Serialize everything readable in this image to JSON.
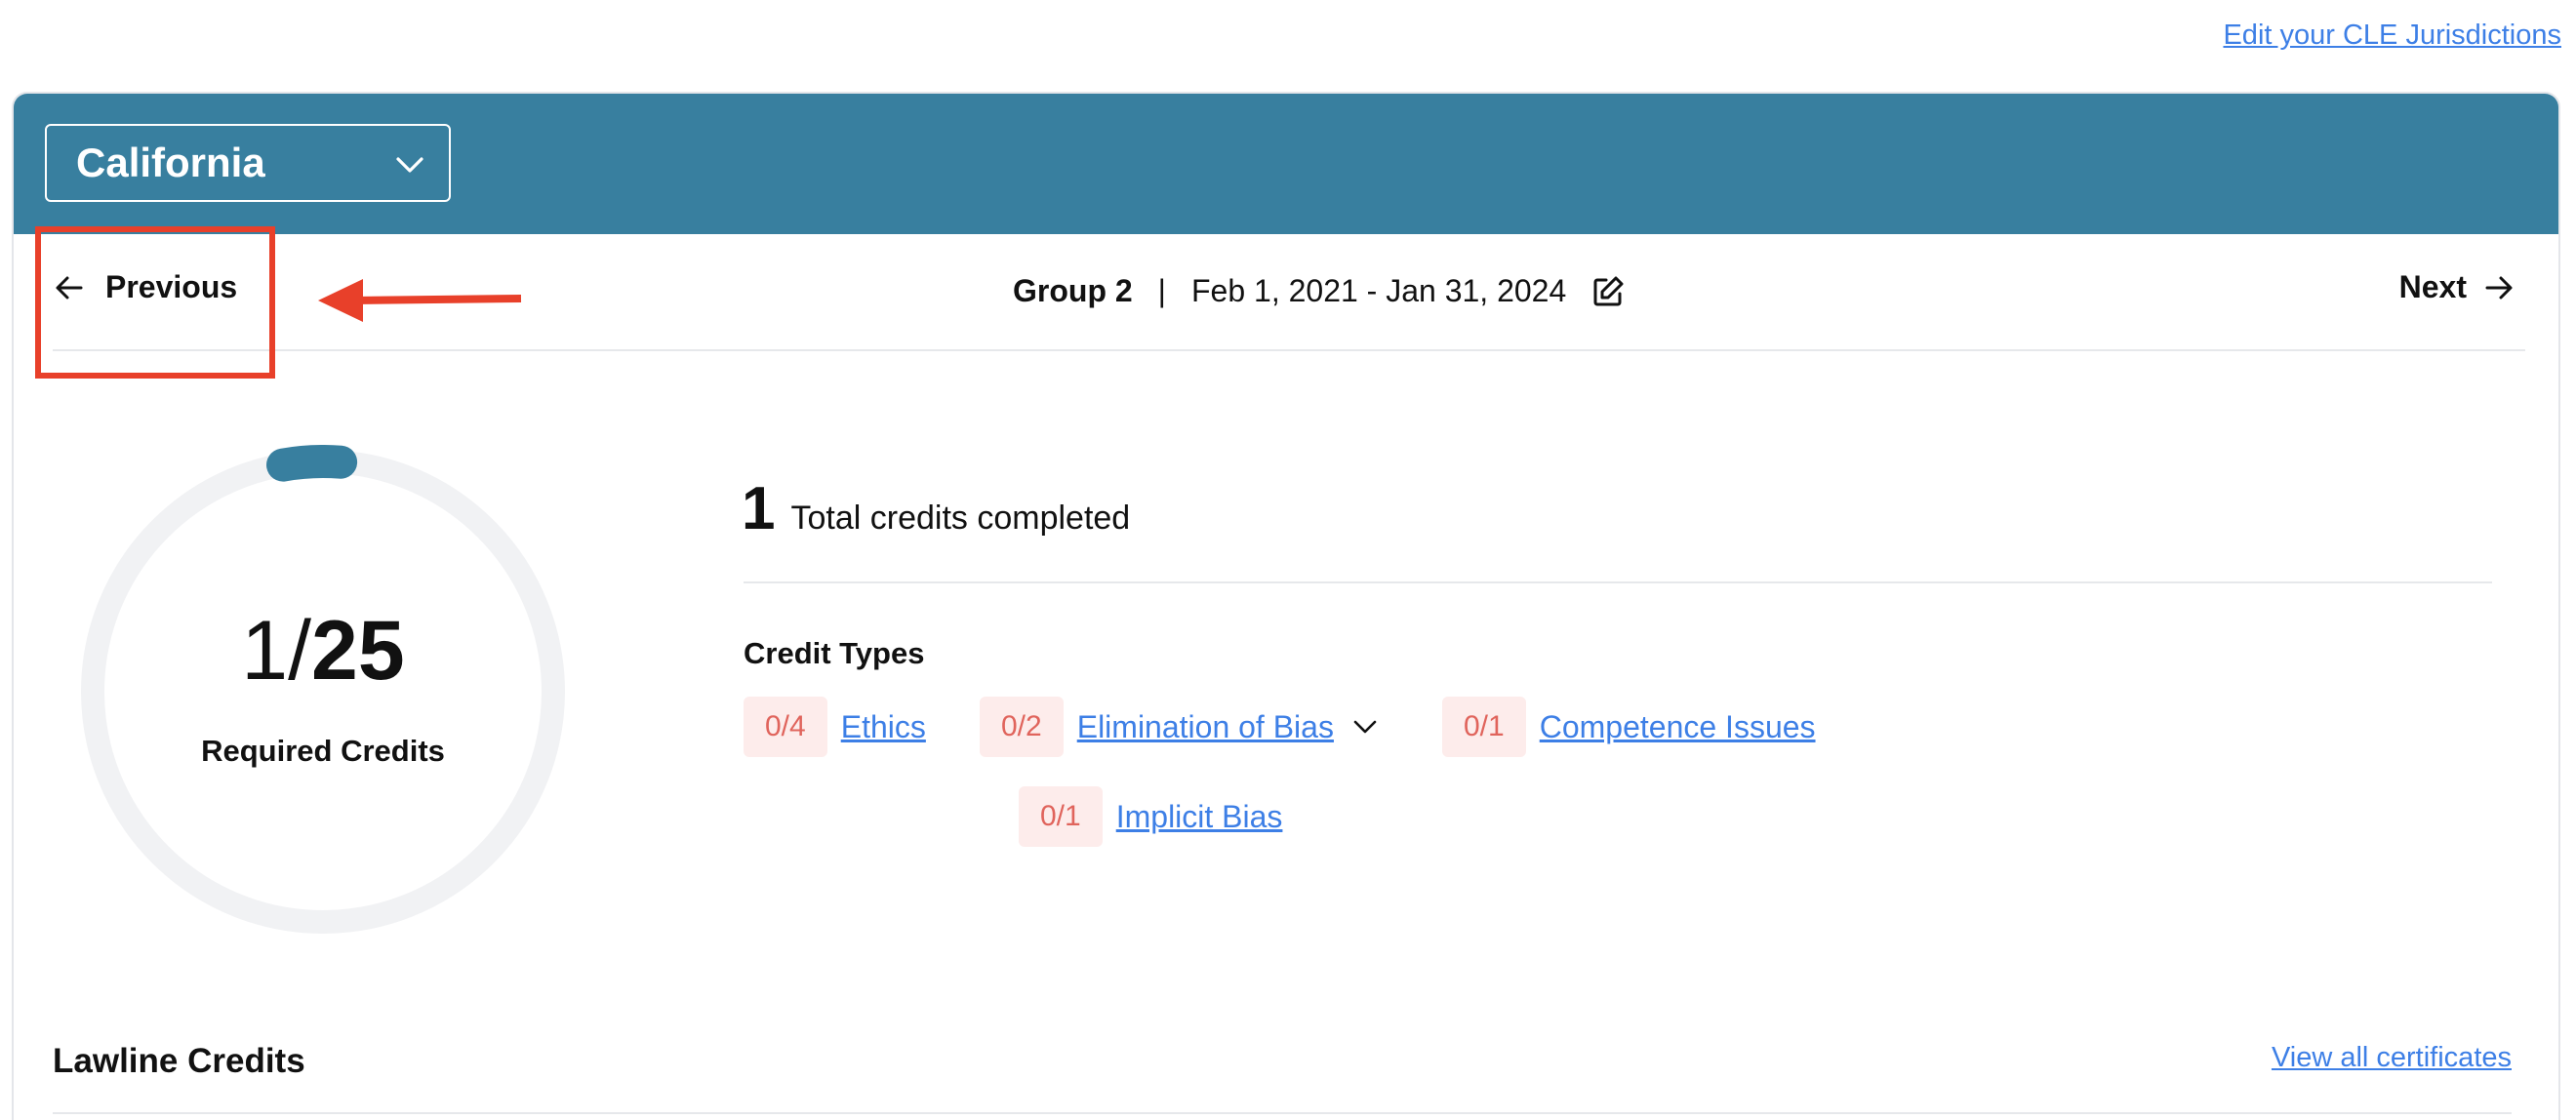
{
  "top_link": "Edit your CLE Jurisdictions",
  "jurisdiction": {
    "selected": "California"
  },
  "nav": {
    "previous_label": "Previous",
    "next_label": "Next",
    "group": "Group 2",
    "separator": "|",
    "period": "Feb 1, 2021 - Jan 31, 2024"
  },
  "progress": {
    "completed": "1",
    "slash": "/",
    "required": "25",
    "label": "Required Credits",
    "fraction": 0.04,
    "accent_color": "#387f9f",
    "track_color": "#f1f2f4"
  },
  "summary": {
    "total_number": "1",
    "total_label": "Total credits completed"
  },
  "credit_types": {
    "title": "Credit Types",
    "items": [
      {
        "count": "0/4",
        "name": "Ethics"
      },
      {
        "count": "0/2",
        "name": "Elimination of Bias"
      },
      {
        "count": "0/1",
        "name": "Competence Issues"
      },
      {
        "count": "0/1",
        "name": "Implicit Bias"
      }
    ]
  },
  "lawline": {
    "title": "Lawline Credits",
    "view_all": "View all certificates"
  },
  "colors": {
    "header": "#387f9f",
    "link": "#3d7fe6",
    "badge_bg": "#fdeceb",
    "badge_text": "#e0645c",
    "annotation": "#e8402a"
  }
}
